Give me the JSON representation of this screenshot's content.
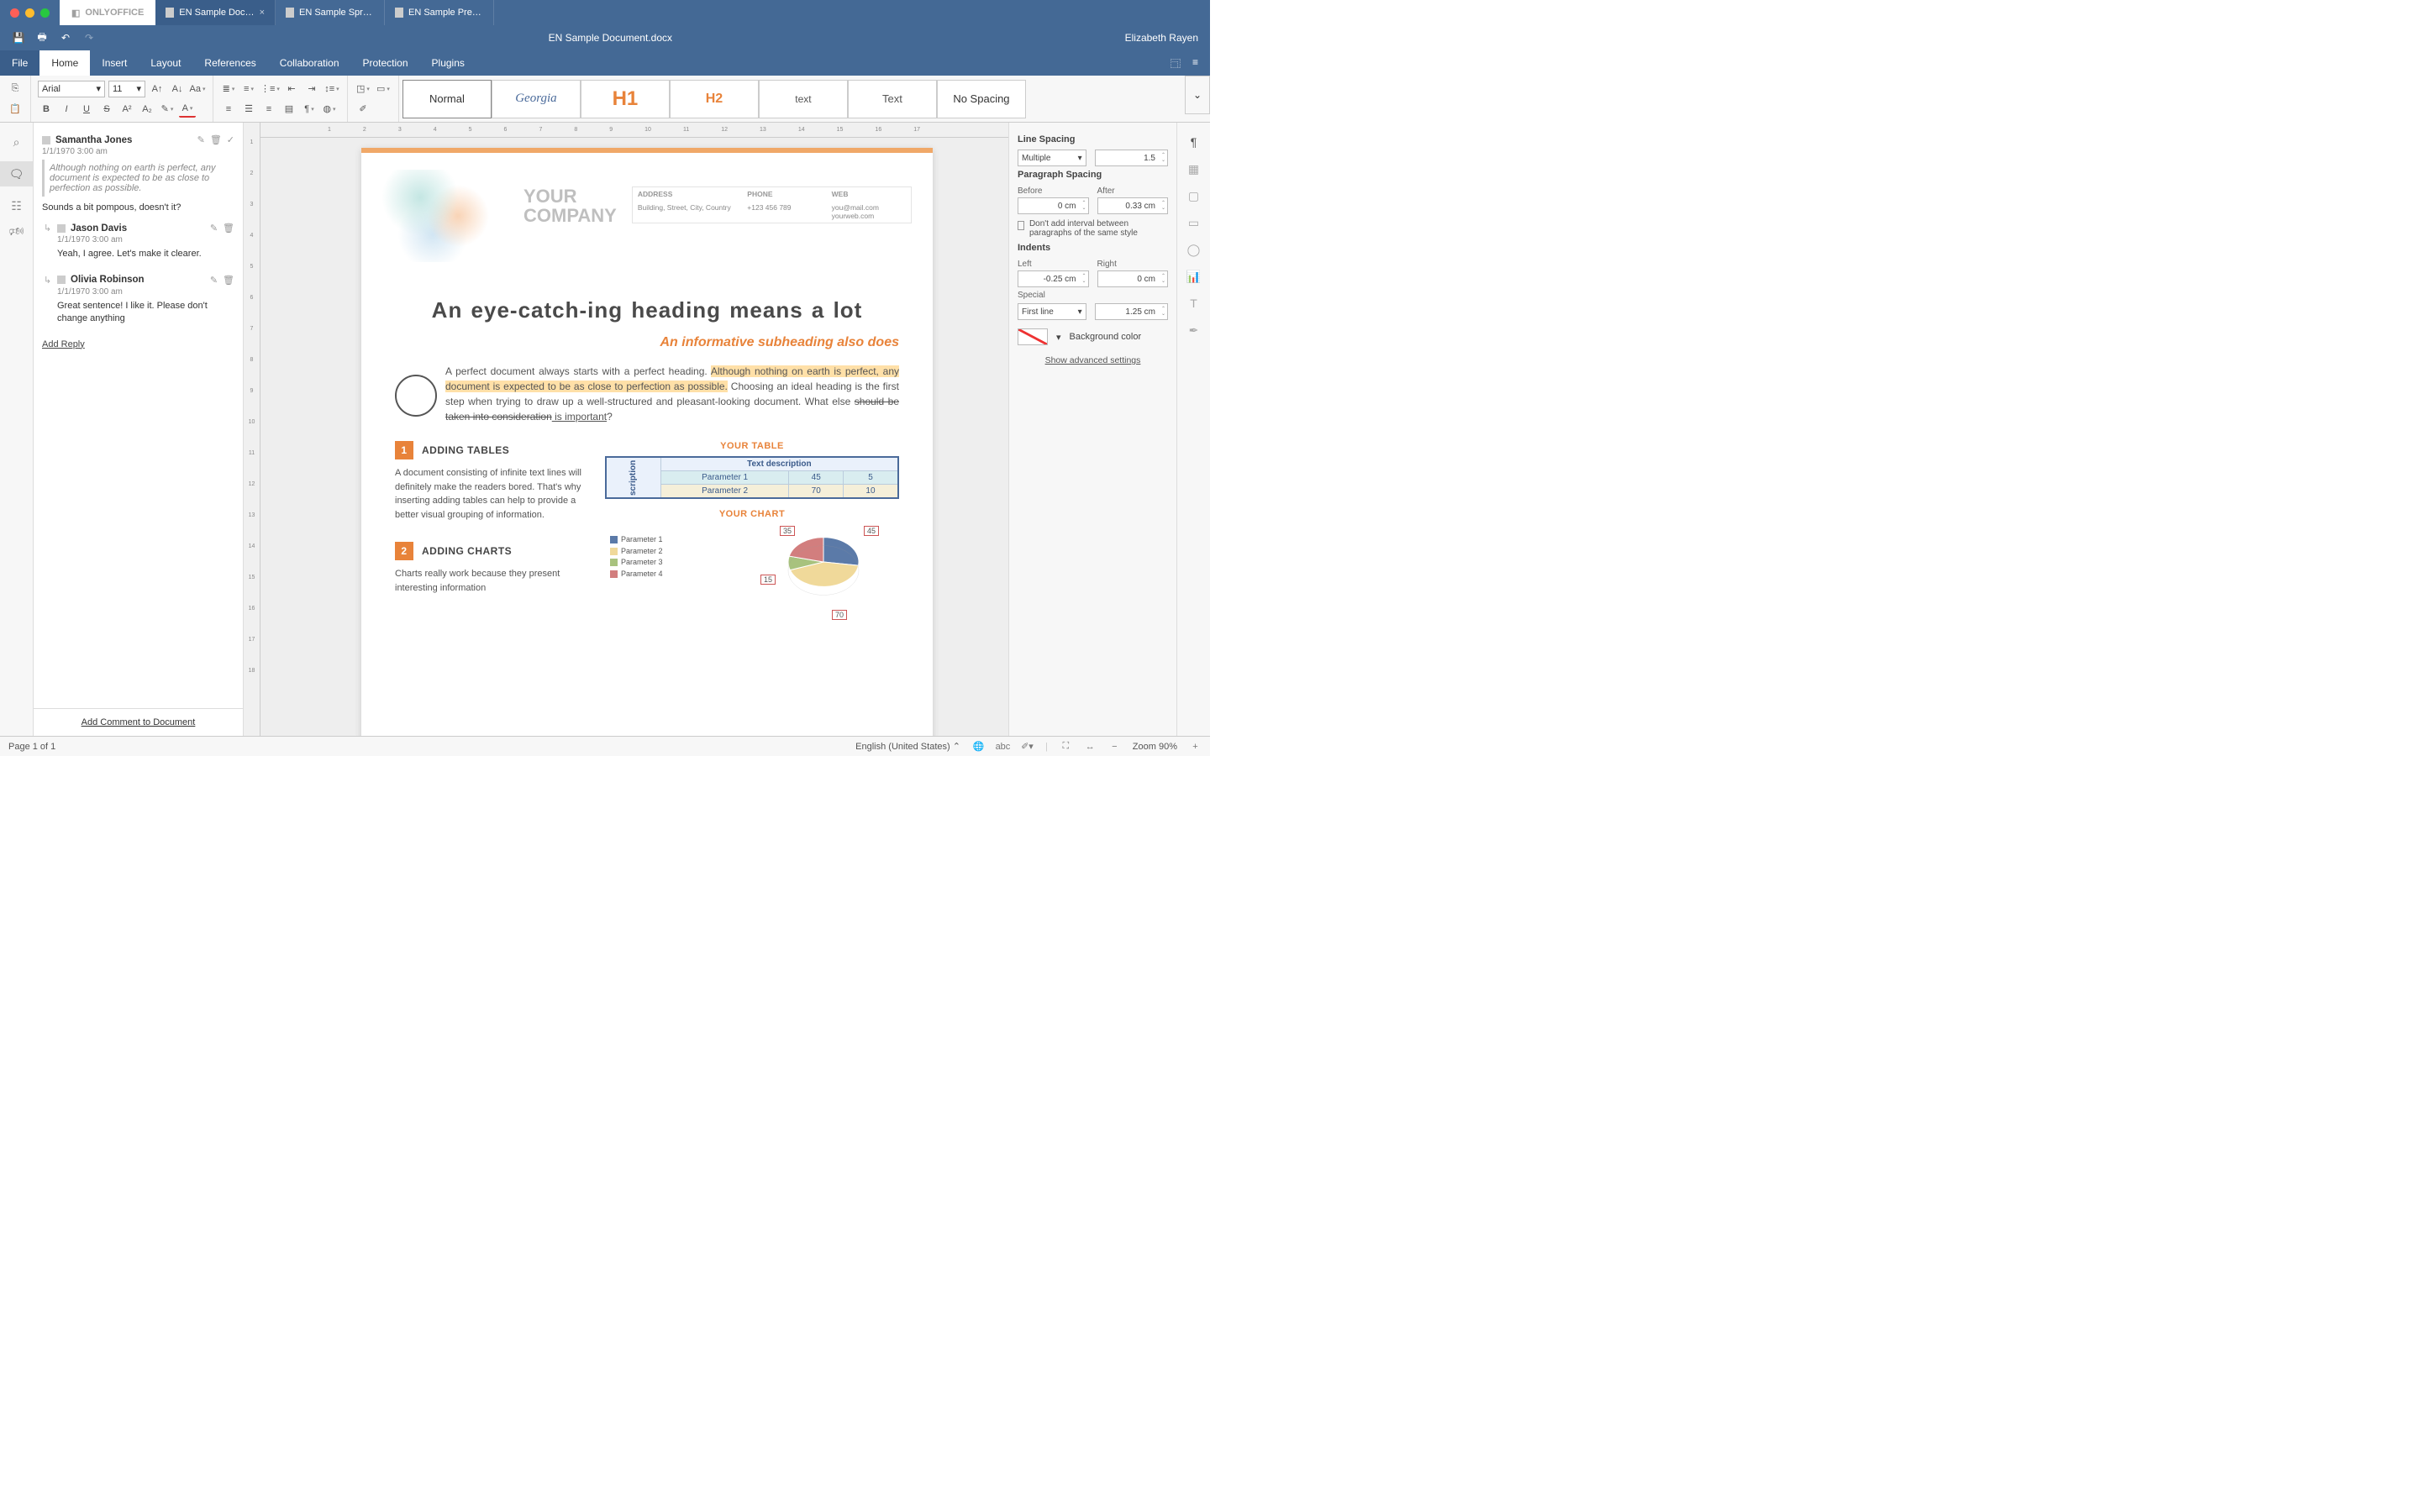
{
  "brand": "ONLYOFFICE",
  "tabs": [
    {
      "label": "EN Sample Doc…",
      "active": true
    },
    {
      "label": "EN Sample Spr…",
      "active": false
    },
    {
      "label": "EN Sample Pre…",
      "active": false
    }
  ],
  "doc_title": "EN Sample Document.docx",
  "user": "Elizabeth Rayen",
  "menu": [
    "File",
    "Home",
    "Insert",
    "Layout",
    "References",
    "Collaboration",
    "Protection",
    "Plugins"
  ],
  "font": {
    "family": "Arial",
    "size": "11"
  },
  "style_boxes": [
    {
      "label": "Normal",
      "css": "color:#333;font-size:13px;"
    },
    {
      "label": "Georgia",
      "css": "color:#4a6a9a;font-family:Georgia,serif;font-size:15px;font-style:italic;"
    },
    {
      "label": "H1",
      "css": "color:#e8833a;font-weight:800;font-size:24px;"
    },
    {
      "label": "H2",
      "css": "color:#e8833a;font-weight:800;font-size:16px;"
    },
    {
      "label": "text",
      "css": "color:#555;font-size:12px;"
    },
    {
      "label": "Text",
      "css": "color:#555;font-size:13px;"
    },
    {
      "label": "No Spacing",
      "css": "color:#333;font-size:13px;"
    }
  ],
  "comments": {
    "thread": {
      "author": "Samantha Jones",
      "time": "1/1/1970 3:00 am",
      "quote": "Although nothing on earth is perfect, any document is expected to be as close to perfection as possible.",
      "text": "Sounds a bit pompous, doesn't it?",
      "replies": [
        {
          "author": "Jason Davis",
          "time": "1/1/1970 3:00 am",
          "text": "Yeah, I agree. Let's make it clearer."
        },
        {
          "author": "Olivia Robinson",
          "time": "1/1/1970 3:00 am",
          "text": "Great sentence! I like it. Please don't change anything"
        }
      ],
      "add_reply": "Add Reply"
    },
    "add_comment": "Add Comment to Document"
  },
  "doc": {
    "company_top": "YOUR",
    "company_bottom": "COMPANY",
    "info": {
      "address_h": "ADDRESS",
      "address": "Building, Street, City, Country",
      "phone_h": "PHONE",
      "phone": "+123 456 789",
      "web_h": "WEB",
      "web1": "you@mail.com",
      "web2": "yourweb.com"
    },
    "h1": "An eye-catch-ing heading means a lot",
    "h2": "An informative subheading also does",
    "p1a": "A perfect document always starts with a perfect heading. ",
    "p1b": "Although nothing on earth is perfect, any document is expected to be as close to perfection as possible.",
    "p1c": " Choosing an ideal heading is the first step when trying to draw up a well-structured and pleasant-looking document. What else ",
    "p1d": "should be taken into consideration",
    "p1e": " is important",
    "sec1_num": "1",
    "sec1_title": "ADDING TABLES",
    "sec1_p": "A document consisting of infinite text lines will definitely make the readers bored. That's why inserting adding tables can help to provide a better visual grouping of information.",
    "sec2_num": "2",
    "sec2_title": "ADDING CHARTS",
    "sec2_p": "Charts really work because they present interesting information",
    "table_title": "YOUR TABLE",
    "table_desc": "Text description",
    "table_side": "scription",
    "table_rows": [
      {
        "name": "Parameter 1",
        "a": "45",
        "b": "5"
      },
      {
        "name": "Parameter 2",
        "a": "70",
        "b": "10"
      }
    ],
    "chart_title": "YOUR CHART",
    "chart_legend": [
      "Parameter 1",
      "Parameter 2",
      "Parameter 3",
      "Parameter 4"
    ]
  },
  "chart_data": {
    "type": "pie",
    "title": "YOUR CHART",
    "series": [
      {
        "name": "Parameter 1",
        "value": 45,
        "color": "#5b7aa8"
      },
      {
        "name": "Parameter 2",
        "value": 70,
        "color": "#f0d99a"
      },
      {
        "name": "Parameter 3",
        "value": 15,
        "color": "#a8c27e"
      },
      {
        "name": "Parameter 4",
        "value": 35,
        "color": "#d27e7e"
      }
    ]
  },
  "right": {
    "line_spacing": "Line Spacing",
    "ls_mode": "Multiple",
    "ls_val": "1.5",
    "para_spacing": "Paragraph Spacing",
    "before": "Before",
    "before_v": "0 cm",
    "after": "After",
    "after_v": "0.33 cm",
    "no_interval": "Don't add interval between paragraphs of the same style",
    "indents": "Indents",
    "left": "Left",
    "left_v": "-0.25 cm",
    "right_l": "Right",
    "right_v": "0 cm",
    "special": "Special",
    "special_mode": "First line",
    "special_v": "1.25 cm",
    "bg": "Background color",
    "advanced": "Show advanced settings"
  },
  "status": {
    "page": "Page 1 of 1",
    "lang": "English (United States)",
    "zoom": "Zoom 90%"
  }
}
